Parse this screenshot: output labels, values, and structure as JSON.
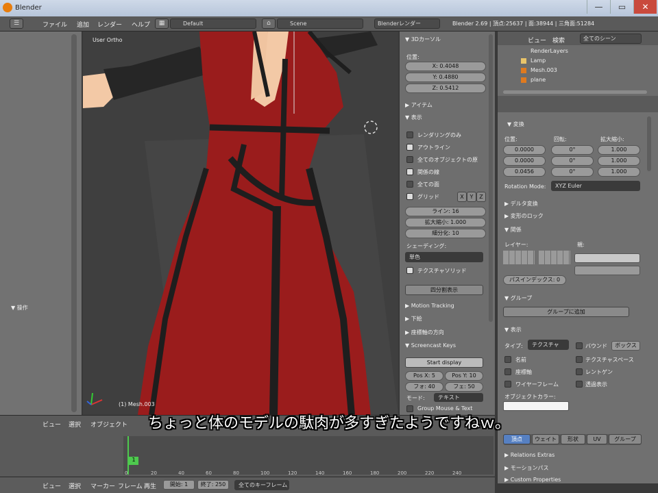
{
  "window": {
    "title": "Blender",
    "min": "—",
    "max": "▭",
    "close": "✕"
  },
  "menubar": {
    "items": [
      "ファイル",
      "追加",
      "レンダー",
      "ヘルプ"
    ],
    "layout": "Default",
    "scene": "Scene",
    "engine": "Blenderレンダー",
    "info": "Blender 2.69 | 頂点:25637 | 面:38944 | 三角面:51284"
  },
  "leftpanel": {
    "header": "▼ 操作"
  },
  "viewport": {
    "label": "User Ortho",
    "object_label": "(1) Mesh.003"
  },
  "npanel": {
    "transform": "▼ 3Dカーソル",
    "loc_label": "位置:",
    "x": "X: 0.4048",
    "y": "Y: 0.4880",
    "z": "Z: 0.5412",
    "item": "▶ アイテム",
    "display": "▼ 表示",
    "only_render": "レンダリングのみ",
    "outline": "アウトライン",
    "all_edges": "全てのオブジェクトの原",
    "relationship": "関係の線",
    "all_z": "全ての面",
    "grid_floor": "グリッド",
    "grid_axes": [
      "X",
      "Y",
      "Z"
    ],
    "lines": "ライン: 16",
    "scale": "拡大縮小: 1.000",
    "subdiv": "細分化: 10",
    "shading_label": "シェーディング:",
    "shading_value": "単色",
    "textured_solid": "テクスチャソリッド",
    "toggle_quad": "四分割表示",
    "motion_tracking": "▶ Motion Tracking",
    "background": "▶ 下絵",
    "transform_orient": "▶ 座標軸の方向",
    "screencast": "▼ Screencast Keys",
    "start_display": "Start display",
    "posx": "Pos X: 5",
    "posy": "Pos Y: 10",
    "fontsize": "フォ: 40",
    "fadetime": "フェ: 50",
    "mode_label": "モード:",
    "mode_value": "テキスト",
    "group_mode": "Group Mouse & Text"
  },
  "outliner": {
    "menu": [
      "ビュー",
      "検索"
    ],
    "filter": "全てのシーン",
    "items": [
      "RenderLayers",
      "Lamp",
      "Mesh.003",
      "plane"
    ]
  },
  "props": {
    "transform": "▼ 変換",
    "col_loc": "位置:",
    "col_rot": "回転:",
    "col_scale": "拡大縮小:",
    "loc": [
      "0.0000",
      "0.0000",
      "0.0456"
    ],
    "rot": [
      "0°",
      "0°",
      "0°"
    ],
    "scale": [
      "1.000",
      "1.000",
      "1.000"
    ],
    "rotmode_label": "Rotation Mode:",
    "rotmode": "XYZ Euler",
    "delta": "▶ デルタ変換",
    "lock": "▶ 変形のロック",
    "relations": "▼ 関係",
    "layers_label": "レイヤー:",
    "parent": "親:",
    "pass_index": "パスインデックス: 0",
    "groups": "▼ グループ",
    "add_group": "グループに追加",
    "display": "▼ 表示",
    "type_label": "タイプ:",
    "type_value": "テクスチャ",
    "bounds": "バウンド",
    "bounds_value": "ボックス",
    "name": "名前",
    "axis": "座標軸",
    "wire": "ワイヤーフレーム",
    "tex_space": "テクスチャスペース",
    "xray": "レントゲン",
    "transp": "透過表示",
    "obj_color": "オブジェクトカラー:",
    "tabs": [
      "頂点",
      "ウェイト",
      "形状",
      "UV",
      "グループ"
    ],
    "relations_extras": "▶ Relations Extras",
    "motion_paths": "▶ モーションパス",
    "custom_props": "▶ Custom Properties"
  },
  "timeline": {
    "menu": [
      "ビュー",
      "選択",
      "オブジェクト"
    ],
    "ticks": [
      "0",
      "20",
      "40",
      "60",
      "80",
      "100",
      "120",
      "140",
      "160",
      "180",
      "200",
      "220",
      "240"
    ],
    "frame": "1"
  },
  "bottombar": {
    "menu": [
      "ビュー",
      "選択",
      "マーカー",
      "フレーム",
      "再生"
    ],
    "start": "開始: 1",
    "end": "終了: 250",
    "keying": "全てのキーフレーム"
  },
  "subtitle": "ちょっと体のモデルの駄肉が多すぎたようですねｗ。",
  "colors": {
    "dress": "#9a1c1c",
    "trim": "#1e1e1e",
    "skin": "#f3c9a6",
    "ui_bg": "#707070"
  }
}
